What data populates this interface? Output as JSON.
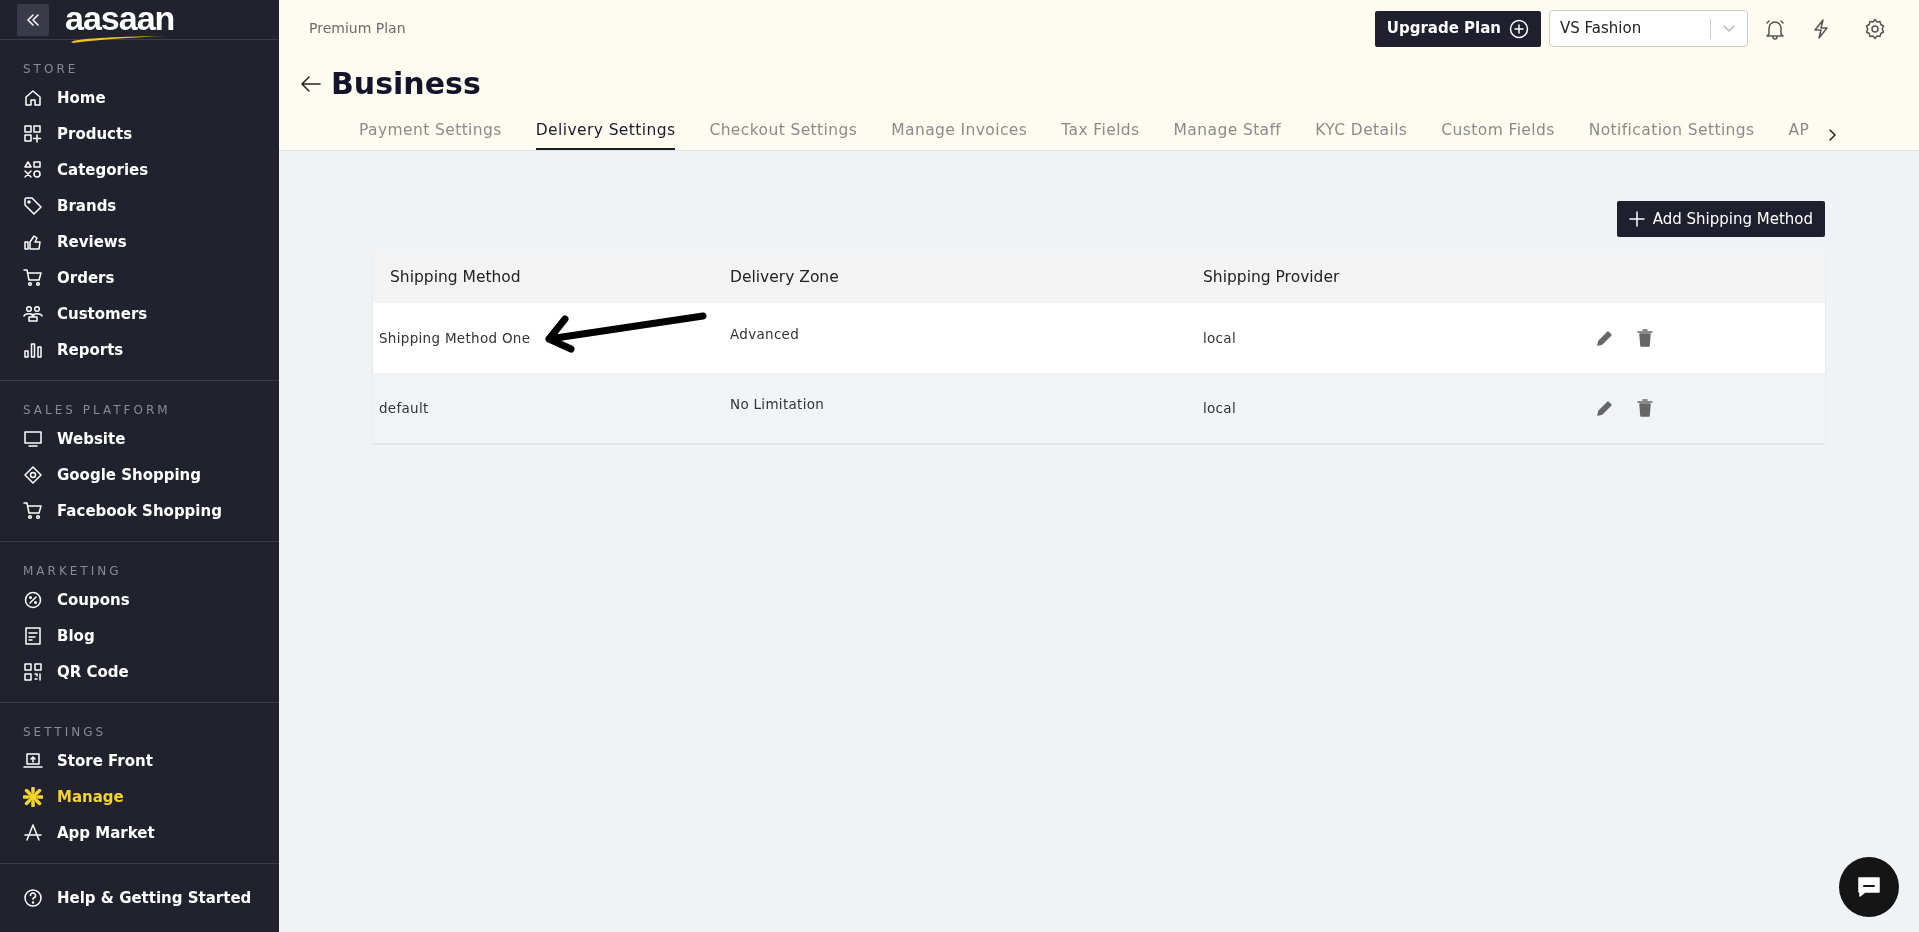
{
  "sidebar": {
    "logo": "aasaan",
    "sections": [
      {
        "title": "STORE",
        "items": [
          {
            "label": "Home",
            "selected": false
          },
          {
            "label": "Products",
            "selected": false
          },
          {
            "label": "Categories",
            "selected": false
          },
          {
            "label": "Brands",
            "selected": false
          },
          {
            "label": "Reviews",
            "selected": false
          },
          {
            "label": "Orders",
            "selected": false
          },
          {
            "label": "Customers",
            "selected": false
          },
          {
            "label": "Reports",
            "selected": false
          }
        ]
      },
      {
        "title": "SALES PLATFORM",
        "items": [
          {
            "label": "Website",
            "selected": false
          },
          {
            "label": "Google Shopping",
            "selected": false
          },
          {
            "label": "Facebook Shopping",
            "selected": false
          }
        ]
      },
      {
        "title": "MARKETING",
        "items": [
          {
            "label": "Coupons",
            "selected": false
          },
          {
            "label": "Blog",
            "selected": false
          },
          {
            "label": "QR Code",
            "selected": false
          }
        ]
      },
      {
        "title": "SETTINGS",
        "items": [
          {
            "label": "Store Front",
            "selected": false
          },
          {
            "label": "Manage",
            "selected": true
          },
          {
            "label": "App Market",
            "selected": false
          }
        ]
      }
    ],
    "footer_item": {
      "label": "Help & Getting Started",
      "selected": false
    }
  },
  "header": {
    "plan": "Premium Plan",
    "upgrade_button": "Upgrade Plan",
    "store_select": {
      "value": "VS Fashion"
    },
    "page_title": "Business",
    "tabs": [
      {
        "label": "Payment Settings",
        "selected": false
      },
      {
        "label": "Delivery Settings",
        "selected": true
      },
      {
        "label": "Checkout Settings",
        "selected": false
      },
      {
        "label": "Manage Invoices",
        "selected": false
      },
      {
        "label": "Tax Fields",
        "selected": false
      },
      {
        "label": "Manage Staff",
        "selected": false
      },
      {
        "label": "KYC Details",
        "selected": false
      },
      {
        "label": "Custom Fields",
        "selected": false
      },
      {
        "label": "Notification Settings",
        "selected": false
      },
      {
        "label": "AP",
        "selected": false
      }
    ]
  },
  "add_button": "Add Shipping Method",
  "table": {
    "columns": [
      "Shipping Method",
      "Delivery Zone",
      "Shipping Provider"
    ],
    "rows": [
      {
        "shipping_method": "Shipping Method One",
        "delivery_zone": "Advanced",
        "shipping_provider": "local"
      },
      {
        "shipping_method": "default",
        "delivery_zone": "No Limitation",
        "shipping_provider": "local"
      }
    ]
  }
}
